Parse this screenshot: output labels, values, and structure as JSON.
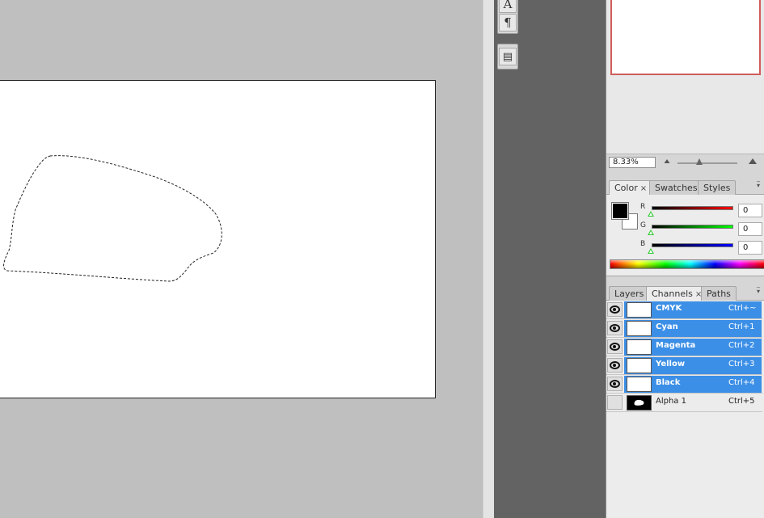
{
  "navigator": {
    "zoom_value": "8.33%",
    "zoom_out_icon": "zoom-out-mountain-icon",
    "zoom_in_icon": "zoom-in-mountain-icon"
  },
  "dock": {
    "tools": [
      {
        "icon": "character-panel-icon",
        "glyph": "A"
      },
      {
        "icon": "paragraph-panel-icon",
        "glyph": "¶"
      },
      {
        "icon": "tool-presets-icon",
        "glyph": "▤"
      }
    ]
  },
  "color_panel": {
    "tabs": [
      {
        "label": "Color",
        "active": true,
        "close": "×"
      },
      {
        "label": "Swatches",
        "active": false
      },
      {
        "label": "Styles",
        "active": false
      }
    ],
    "foreground_color": "#000000",
    "background_color": "#ffffff",
    "sliders": [
      {
        "letter": "R",
        "value": "0",
        "track_from": "#000000",
        "track_to": "#ff0000"
      },
      {
        "letter": "G",
        "value": "0",
        "track_from": "#000000",
        "track_to": "#00ff00"
      },
      {
        "letter": "B",
        "value": "0",
        "track_from": "#000000",
        "track_to": "#0000ff"
      }
    ]
  },
  "channels_panel": {
    "tabs": [
      {
        "label": "Layers",
        "active": false
      },
      {
        "label": "Channels",
        "active": true,
        "close": "×"
      },
      {
        "label": "Paths",
        "active": false
      }
    ],
    "channels": [
      {
        "name": "CMYK",
        "shortcut": "Ctrl+~",
        "visible": true,
        "selected": true
      },
      {
        "name": "Cyan",
        "shortcut": "Ctrl+1",
        "visible": true,
        "selected": true
      },
      {
        "name": "Magenta",
        "shortcut": "Ctrl+2",
        "visible": true,
        "selected": true
      },
      {
        "name": "Yellow",
        "shortcut": "Ctrl+3",
        "visible": true,
        "selected": true
      },
      {
        "name": "Black",
        "shortcut": "Ctrl+4",
        "visible": true,
        "selected": true
      },
      {
        "name": "Alpha 1",
        "shortcut": "Ctrl+5",
        "visible": false,
        "selected": false
      }
    ]
  },
  "colors": {
    "selection_highlight": "#3c8fe6",
    "navigator_frame": "#d05c5c",
    "workspace": "#bfbfbf",
    "dock": "#636363"
  }
}
